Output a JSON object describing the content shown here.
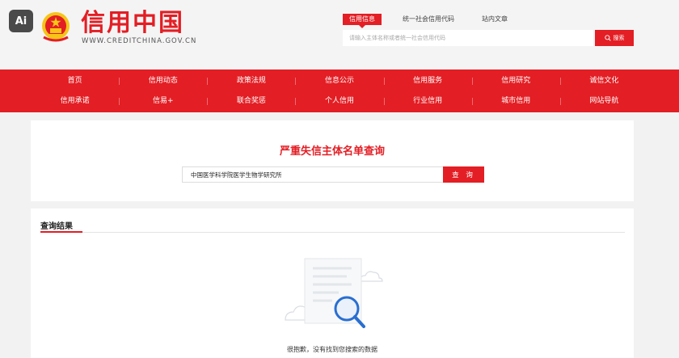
{
  "header": {
    "badge": "Ai",
    "logo_title": "信用中国",
    "logo_url": "WWW.CREDITCHINA.GOV.CN",
    "search_tabs": [
      "信用信息",
      "统一社会信用代码",
      "站内文章"
    ],
    "search_placeholder": "请输入主体名称或者统一社会信用代码",
    "search_button": "搜索"
  },
  "nav": {
    "row1": [
      "首页",
      "信用动态",
      "政策法规",
      "信息公示",
      "信用服务",
      "信用研究",
      "诚信文化"
    ],
    "row2": [
      "信用承诺",
      "信易+",
      "联合奖惩",
      "个人信用",
      "行业信用",
      "城市信用",
      "网站导航"
    ]
  },
  "query": {
    "title": "严重失信主体名单查询",
    "input_value": "中国医学科学院医学生物学研究所",
    "button": "查 询"
  },
  "results": {
    "title": "查询结果",
    "empty_text": "很抱歉，没有找到您搜索的数据"
  },
  "colors": {
    "brand_red": "#e31e24",
    "accent_blue": "#2a6fd1"
  }
}
